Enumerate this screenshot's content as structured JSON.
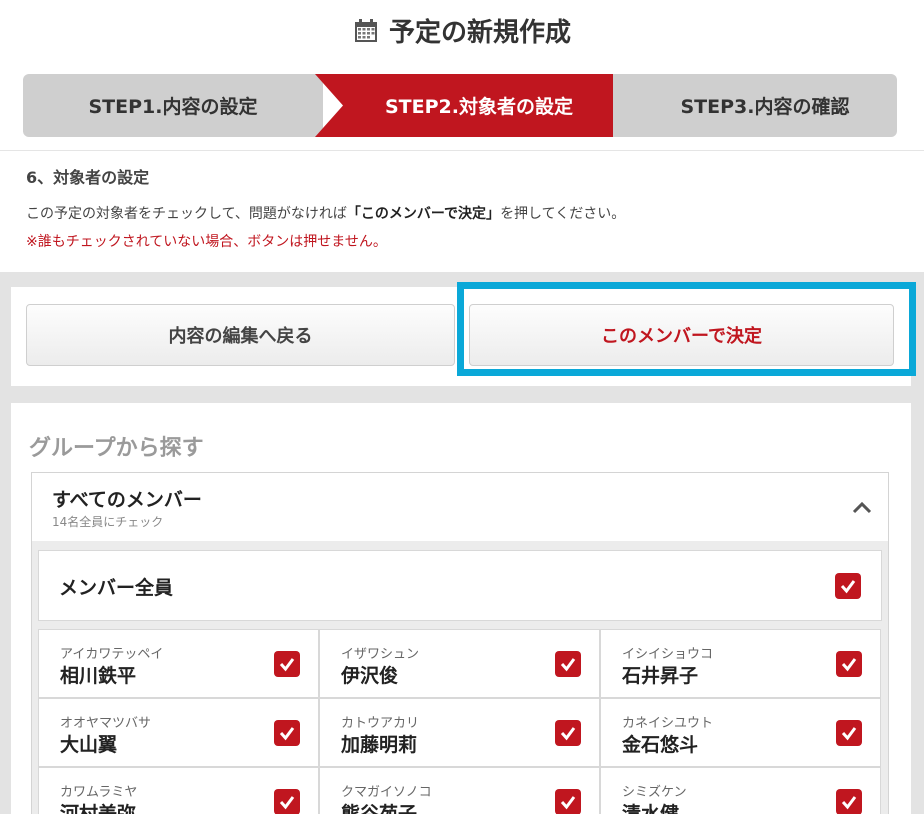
{
  "page": {
    "title": "予定の新規作成"
  },
  "icons": {
    "calendar": "calendar-icon",
    "chevron": "chevron-up-icon",
    "check": "check-icon"
  },
  "colors": {
    "accent": "#c0161f",
    "highlight": "#0aa8d8",
    "step_inactive": "#cfcfcf"
  },
  "steps": [
    {
      "label": "STEP1.内容の設定",
      "active": false
    },
    {
      "label": "STEP2.対象者の設定",
      "active": true
    },
    {
      "label": "STEP3.内容の確認",
      "active": false
    }
  ],
  "section": {
    "heading": "6、対象者の設定",
    "desc_before": "この予定の対象者をチェックして、問題がなければ",
    "desc_bold": "「このメンバーで決定」",
    "desc_after": "を押してください。",
    "warning": "※誰もチェックされていない場合、ボタンは押せません。"
  },
  "buttons": {
    "back": "内容の編集へ戻る",
    "confirm": "このメンバーで決定"
  },
  "group": {
    "title": "グループから探す",
    "accordion_title": "すべてのメンバー",
    "accordion_sub": "14名全員にチェック",
    "all_label": "メンバー全員",
    "all_checked": true
  },
  "members": [
    {
      "kana": "アイカワテッペイ",
      "name": "相川鉄平",
      "checked": true
    },
    {
      "kana": "イザワシュン",
      "name": "伊沢俊",
      "checked": true
    },
    {
      "kana": "イシイショウコ",
      "name": "石井昇子",
      "checked": true
    },
    {
      "kana": "オオヤマツバサ",
      "name": "大山翼",
      "checked": true
    },
    {
      "kana": "カトウアカリ",
      "name": "加藤明莉",
      "checked": true
    },
    {
      "kana": "カネイシユウト",
      "name": "金石悠斗",
      "checked": true
    },
    {
      "kana": "カワムラミヤ",
      "name": "河村美弥",
      "checked": true
    },
    {
      "kana": "クマガイソノコ",
      "name": "熊谷苑子",
      "checked": true
    },
    {
      "kana": "シミズケン",
      "name": "清水健",
      "checked": true
    }
  ]
}
